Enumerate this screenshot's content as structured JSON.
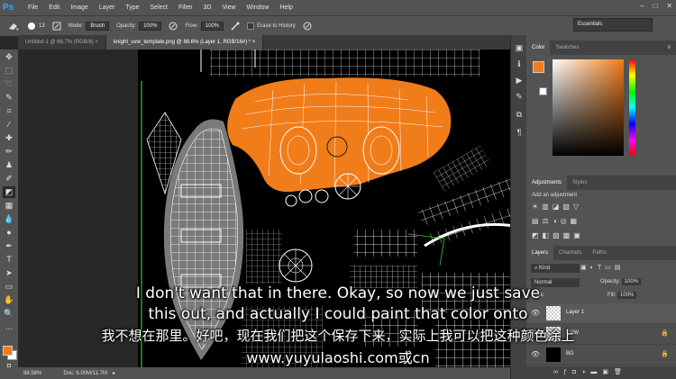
{
  "menubar": {
    "logo": "Ps",
    "items": [
      "File",
      "Edit",
      "Image",
      "Layer",
      "Type",
      "Select",
      "Filter",
      "3D",
      "View",
      "Window",
      "Help"
    ],
    "window_controls": [
      "–",
      "□",
      "✕"
    ]
  },
  "options": {
    "brush_size": "13",
    "mode_label": "Mode:",
    "mode_value": "Brush",
    "opacity_label": "Opacity:",
    "opacity_value": "100%",
    "flow_label": "Flow:",
    "flow_value": "100%",
    "erase_history": "Erase to History",
    "workspace": "Essentials"
  },
  "tabs": [
    {
      "label": "Untitled-1 @ 66.7% (RGB/8) ×"
    },
    {
      "label": "knight_uvw_template.png @ 88.6% (Layer 1, RGB/16#) * ×"
    }
  ],
  "status": {
    "zoom": "88.58%",
    "doc": "Doc: 6.00M/11.7M"
  },
  "color_panel": {
    "tabs": [
      "Color",
      "Swatches"
    ],
    "fg_color": "#f07c1a",
    "bg_color": "#ffffff"
  },
  "adjustments_panel": {
    "tabs": [
      "Adjustments",
      "Styles"
    ],
    "add_label": "Add an adjustment"
  },
  "layers_panel": {
    "tabs": [
      "Layers",
      "Channels",
      "Paths"
    ],
    "filter_label": "Kind",
    "blend_mode": "Normal",
    "opacity_label": "Opacity:",
    "opacity_value": "100%",
    "lock_label": "Lock:",
    "fill_label": "Fill:",
    "fill_value": "100%",
    "layers": [
      {
        "name": "Layer 1"
      },
      {
        "name": "UVW"
      },
      {
        "name": "BG"
      }
    ]
  },
  "subtitles": {
    "en_line1": "I don't want that in there. Okay, so now we just save",
    "en_line2": "this out, and actually I could paint that color onto",
    "zh_line": "我不想在那里。好吧，现在我们把这个保存下来，实际上我可以把这种颜色涂上",
    "url_line": "www.yuyulaoshi.com或cn"
  }
}
